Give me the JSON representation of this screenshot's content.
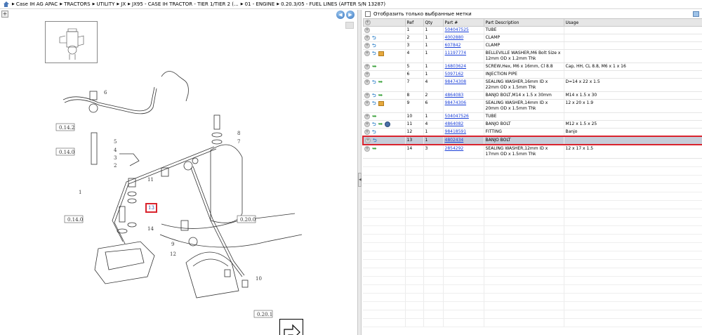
{
  "breadcrumb": [
    "Case IH AG APAC",
    "TRACTORS",
    "UTILITY",
    "JX",
    "JX95 - CASE IH TRACTOR - TIER 1/TIER 2 (...",
    "01 - ENGINE",
    "0.20.3/05 - FUEL LINES (AFTER S/N 13287)"
  ],
  "filter_label": "Отобразить только выбранные метки",
  "columns": [
    "",
    "Ref",
    "Qty",
    "Part #",
    "Part Description",
    "Usage"
  ],
  "rows": [
    {
      "ref": "1",
      "qty": "1",
      "part": "504047525",
      "desc": "TUBE",
      "usage": "",
      "icons": []
    },
    {
      "ref": "2",
      "qty": "1",
      "part": "4002880",
      "desc": "CLAMP",
      "usage": "",
      "icons": [
        "info"
      ]
    },
    {
      "ref": "3",
      "qty": "1",
      "part": "607842",
      "desc": "CLAMP",
      "usage": "",
      "icons": [
        "info"
      ]
    },
    {
      "ref": "4",
      "qty": "1",
      "part": "11197774",
      "desc": "BELLEVILLE WASHER,M6 Bolt Size x 12mm OD x 1.2mm Thk",
      "usage": "",
      "icons": [
        "info",
        "box"
      ]
    },
    {
      "ref": "5",
      "qty": "1",
      "part": "16803624",
      "desc": "SCREW,Hex, M6 x 16mm, Cl 8.8",
      "usage": "Cap, HH, CL 8.8, M6 x 1 x 16",
      "icons": [
        "arrow"
      ]
    },
    {
      "ref": "6",
      "qty": "1",
      "part": "5097162",
      "desc": "INJECTION PIPE",
      "usage": "",
      "icons": []
    },
    {
      "ref": "7",
      "qty": "4",
      "part": "98474308",
      "desc": "SEALING WASHER,16mm ID x 22mm OD x 1.5mm Thk",
      "usage": "D=14 x 22 x 1.5",
      "icons": [
        "info",
        "arrow"
      ]
    },
    {
      "ref": "8",
      "qty": "2",
      "part": "4864083",
      "desc": "BANJO BOLT,M14 x 1.5 x 30mm",
      "usage": "M14 x 1.5 x 30",
      "icons": [
        "info",
        "arrow"
      ]
    },
    {
      "ref": "9",
      "qty": "6",
      "part": "98474306",
      "desc": "SEALING WASHER,14mm ID x 20mm OD x 1.5mm Thk",
      "usage": "12 x 20 x 1.9",
      "icons": [
        "info",
        "box"
      ]
    },
    {
      "ref": "10",
      "qty": "1",
      "part": "504047526",
      "desc": "TUBE",
      "usage": "",
      "icons": [
        "arrow"
      ]
    },
    {
      "ref": "11",
      "qty": "4",
      "part": "4864082",
      "desc": "BANJO BOLT",
      "usage": "M12 x 1.5 x 25",
      "icons": [
        "info",
        "arrow",
        "circ"
      ]
    },
    {
      "ref": "12",
      "qty": "1",
      "part": "98418591",
      "desc": "FITTING",
      "usage": "Banjo",
      "icons": [
        "info"
      ]
    },
    {
      "ref": "13",
      "qty": "1",
      "part": "4802434",
      "desc": "BANJO BOLT",
      "usage": "",
      "icons": [
        "info"
      ],
      "selected": true
    },
    {
      "ref": "14",
      "qty": "3",
      "part": "2854292",
      "desc": "SEALING WASHER,12mm ID x 17mm OD x 1.5mm Thk",
      "usage": "12 x 17 x 1.5",
      "icons": [
        "arrow"
      ]
    }
  ],
  "diagram": {
    "highlight_ref": "13",
    "refs": [
      "0.14.2",
      "0.14.0",
      "0.14.0",
      "0.20.0",
      "0.20.1",
      "1",
      "2",
      "3",
      "4",
      "5",
      "6",
      "7",
      "8",
      "9",
      "10",
      "11",
      "12",
      "14"
    ]
  },
  "icons": {
    "home": "home-icon",
    "zoom": "zoom-in-icon",
    "prev": "arrow-left-icon",
    "next": "arrow-right-icon",
    "filter": "filter-icon"
  },
  "colors": {
    "selection_border": "#d9232d",
    "selection_bg": "#c6ccd8",
    "link": "#1a3fd8"
  }
}
